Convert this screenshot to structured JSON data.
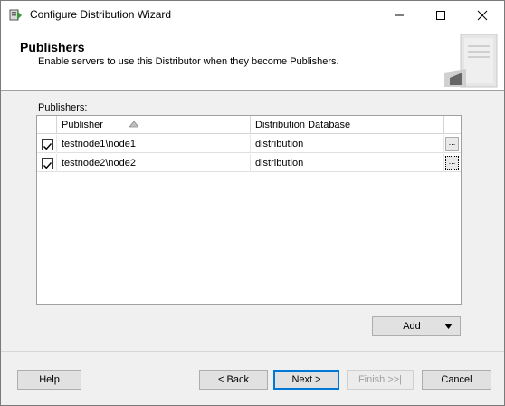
{
  "window": {
    "title": "Configure Distribution Wizard"
  },
  "header": {
    "title": "Publishers",
    "subtitle": "Enable servers to use this Distributor when they become Publishers."
  },
  "publishers_label": "Publishers:",
  "grid": {
    "columns": [
      "Publisher",
      "Distribution Database"
    ],
    "sorted_column": "Publisher",
    "rows": [
      {
        "checked": true,
        "publisher": "testnode1\\node1",
        "database": "distribution",
        "button": "..."
      },
      {
        "checked": true,
        "publisher": "testnode2\\node2",
        "database": "distribution",
        "button": "..."
      }
    ]
  },
  "buttons": {
    "add": "Add",
    "help": "Help",
    "back": "< Back",
    "next": "Next >",
    "finish": "Finish >>|",
    "cancel": "Cancel"
  },
  "icons": [
    "wizard-app-icon",
    "minimize-icon",
    "maximize-icon",
    "close-icon",
    "server-icon",
    "sort-ascending-icon",
    "checkbox-checked-icon",
    "dropdown-arrow-icon"
  ],
  "colors": {
    "focus_blue": "#0078d7",
    "header_bg": "#ffffff",
    "dialog_bg": "#f0f0f0"
  }
}
